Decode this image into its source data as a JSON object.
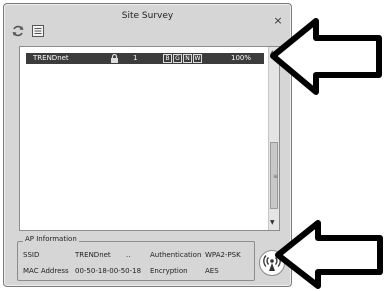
{
  "window": {
    "title": "Site Survey",
    "close_glyph": "×"
  },
  "toolbar": {
    "refresh_icon": "refresh-icon",
    "list_icon": "list-view-icon"
  },
  "networks": [
    {
      "ssid": "TRENDnet",
      "channel": "1",
      "signal": "100%",
      "lock_icon": "lock-icon",
      "flags": [
        "B",
        "G",
        "N",
        "W"
      ]
    }
  ],
  "ap_info": {
    "legend": "AP Information",
    "ssid_label": "SSID",
    "ssid_value": "TRENDnet",
    "ellipsis": "..",
    "auth_label": "Authentication",
    "auth_value": "WPA2-PSK",
    "mac_label": "MAC Address",
    "mac_value": "00-50-18-00-50-18",
    "enc_label": "Encryption",
    "enc_value": "AES"
  },
  "connect_button": {
    "icon": "wireless-antenna-icon"
  },
  "colors": {
    "selected_row": "#3c3c3c",
    "window_bg": "#d6d6d6",
    "arrow_stroke": "#000000"
  }
}
